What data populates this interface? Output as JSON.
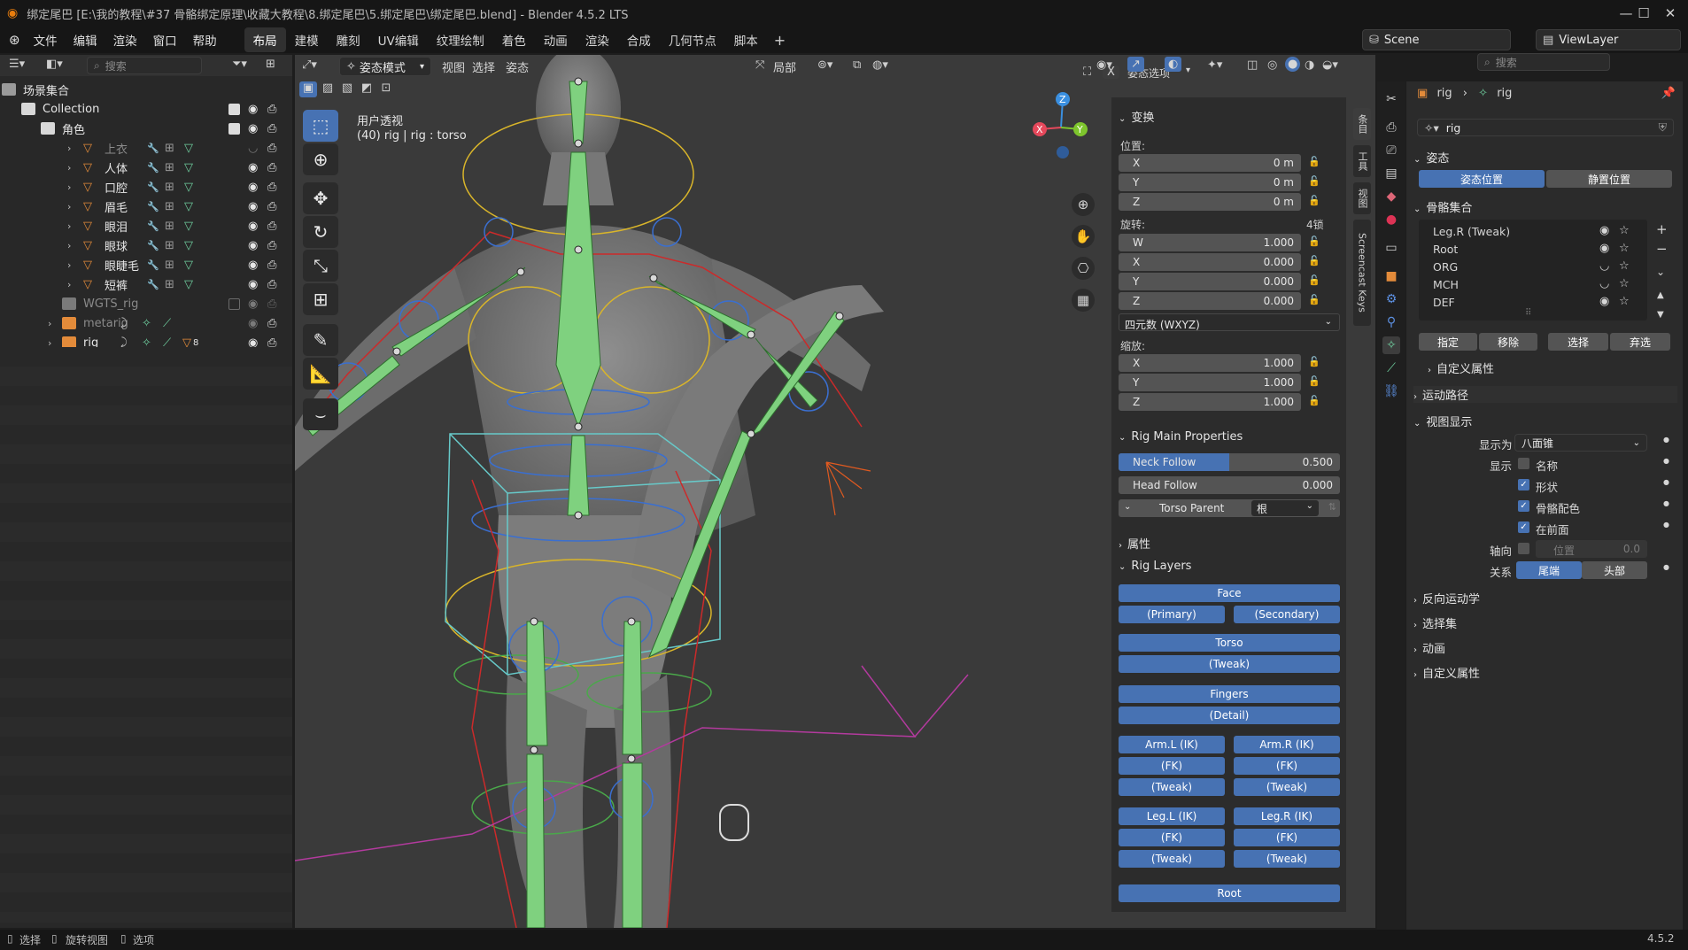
{
  "titlebar": {
    "title": "绑定尾巴 [E:\\我的教程\\#37 骨骼绑定原理\\收藏大教程\\8.绑定尾巴\\5.绑定尾巴\\绑定尾巴.blend] - Blender 4.5.2 LTS",
    "minimize": "—",
    "maximize": "☐",
    "close": "✕"
  },
  "menubar": {
    "menus": [
      "文件",
      "编辑",
      "渲染",
      "窗口",
      "帮助"
    ],
    "workspaces": [
      "布局",
      "建模",
      "雕刻",
      "UV编辑",
      "纹理绘制",
      "着色",
      "动画",
      "渲染",
      "合成",
      "几何节点",
      "脚本"
    ],
    "active_workspace": "布局",
    "scene": "Scene",
    "view_layer": "ViewLayer"
  },
  "outliner": {
    "search_placeholder": "搜索",
    "root": "场景集合",
    "collection": "Collection",
    "sub_collection": "角色",
    "meshes": [
      "上衣",
      "人体",
      "口腔",
      "眉毛",
      "眼泪",
      "眼球",
      "眼睫毛",
      "短裤"
    ],
    "wgts": "WGTS_rig",
    "metarig": "metarig",
    "rig": "rig",
    "rig_count": "8"
  },
  "viewport": {
    "mode": "姿态模式",
    "menus": [
      "视图",
      "选择",
      "姿态"
    ],
    "transform_orientation": "局部",
    "perspective": "用户透视",
    "info": "(40) rig | rig : torso",
    "pose_options": "姿态选项",
    "x_label": "X",
    "gizmo": {
      "x": "X",
      "y": "Y",
      "z": "Z"
    }
  },
  "npanel": {
    "transform_title": "变换",
    "location_label": "位置:",
    "location": [
      {
        "axis": "X",
        "value": "0 m"
      },
      {
        "axis": "Y",
        "value": "0 m"
      },
      {
        "axis": "Z",
        "value": "0 m"
      }
    ],
    "rotation_label": "旋转:",
    "rotation_lock": "4锁",
    "rotation": [
      {
        "axis": "W",
        "value": "1.000"
      },
      {
        "axis": "X",
        "value": "0.000"
      },
      {
        "axis": "Y",
        "value": "0.000"
      },
      {
        "axis": "Z",
        "value": "0.000"
      }
    ],
    "rotation_mode": "四元数 (WXYZ)",
    "scale_label": "缩放:",
    "scale": [
      {
        "axis": "X",
        "value": "1.000"
      },
      {
        "axis": "Y",
        "value": "1.000"
      },
      {
        "axis": "Z",
        "value": "1.000"
      }
    ],
    "rig_main_title": "Rig Main Properties",
    "neck_follow_label": "Neck Follow",
    "neck_follow_value": "0.500",
    "neck_follow_fraction": 0.5,
    "head_follow_label": "Head Follow",
    "head_follow_value": "0.000",
    "torso_parent_label": "Torso Parent",
    "torso_parent_value": "根",
    "properties_title": "属性",
    "rig_layers_title": "Rig Layers",
    "layers": {
      "face": "Face",
      "primary": "(Primary)",
      "secondary": "(Secondary)",
      "torso": "Torso",
      "torso_tweak": "(Tweak)",
      "fingers": "Fingers",
      "detail": "(Detail)",
      "arm_l": "Arm.L (IK)",
      "arm_r": "Arm.R (IK)",
      "fk": "(FK)",
      "tweak": "(Tweak)",
      "leg_l": "Leg.L (IK)",
      "leg_r": "Leg.R (IK)",
      "root": "Root"
    },
    "vtabs": [
      "条目",
      "工具",
      "视图",
      "Screencast Keys"
    ]
  },
  "properties": {
    "search_placeholder": "搜索",
    "breadcrumb_obj": "rig",
    "breadcrumb_data": "rig",
    "name_field": "rig",
    "pose_section": "姿态",
    "pose_position": "姿态位置",
    "rest_position": "静置位置",
    "bone_collections_title": "骨骼集合",
    "bone_collections": [
      "Leg.R (Tweak)",
      "Root",
      "ORG",
      "MCH",
      "DEF"
    ],
    "assign": "指定",
    "remove": "移除",
    "select": "选择",
    "deselect": "弃选",
    "custom_props_inner": "自定义属性",
    "motion_paths": "运动路径",
    "viewport_display": "视图显示",
    "display_as_label": "显示为",
    "display_as_value": "八面锥",
    "show_label": "显示",
    "show_name": "名称",
    "show_shapes": "形状",
    "show_bone_colors": "骨骼配色",
    "show_in_front": "在前面",
    "axes_label": "轴向",
    "axes_position": "位置",
    "axes_value": "0.0",
    "relation_label": "关系",
    "relation_tail": "尾端",
    "relation_head": "头部",
    "ik": "反向运动学",
    "selection_sets": "选择集",
    "animation": "动画",
    "custom_props": "自定义属性"
  },
  "statusbar": {
    "select": "选择",
    "rotate_view": "旋转视图",
    "options": "选项",
    "version": "4.5.2"
  },
  "colors": {
    "accent_blue": "#4772b3",
    "mesh_orange": "#e38b3a",
    "bone_green": "#6fcf6f",
    "gizmo_x": "#e5485b",
    "gizmo_y": "#7ec52d",
    "gizmo_z": "#3a8fe0"
  }
}
